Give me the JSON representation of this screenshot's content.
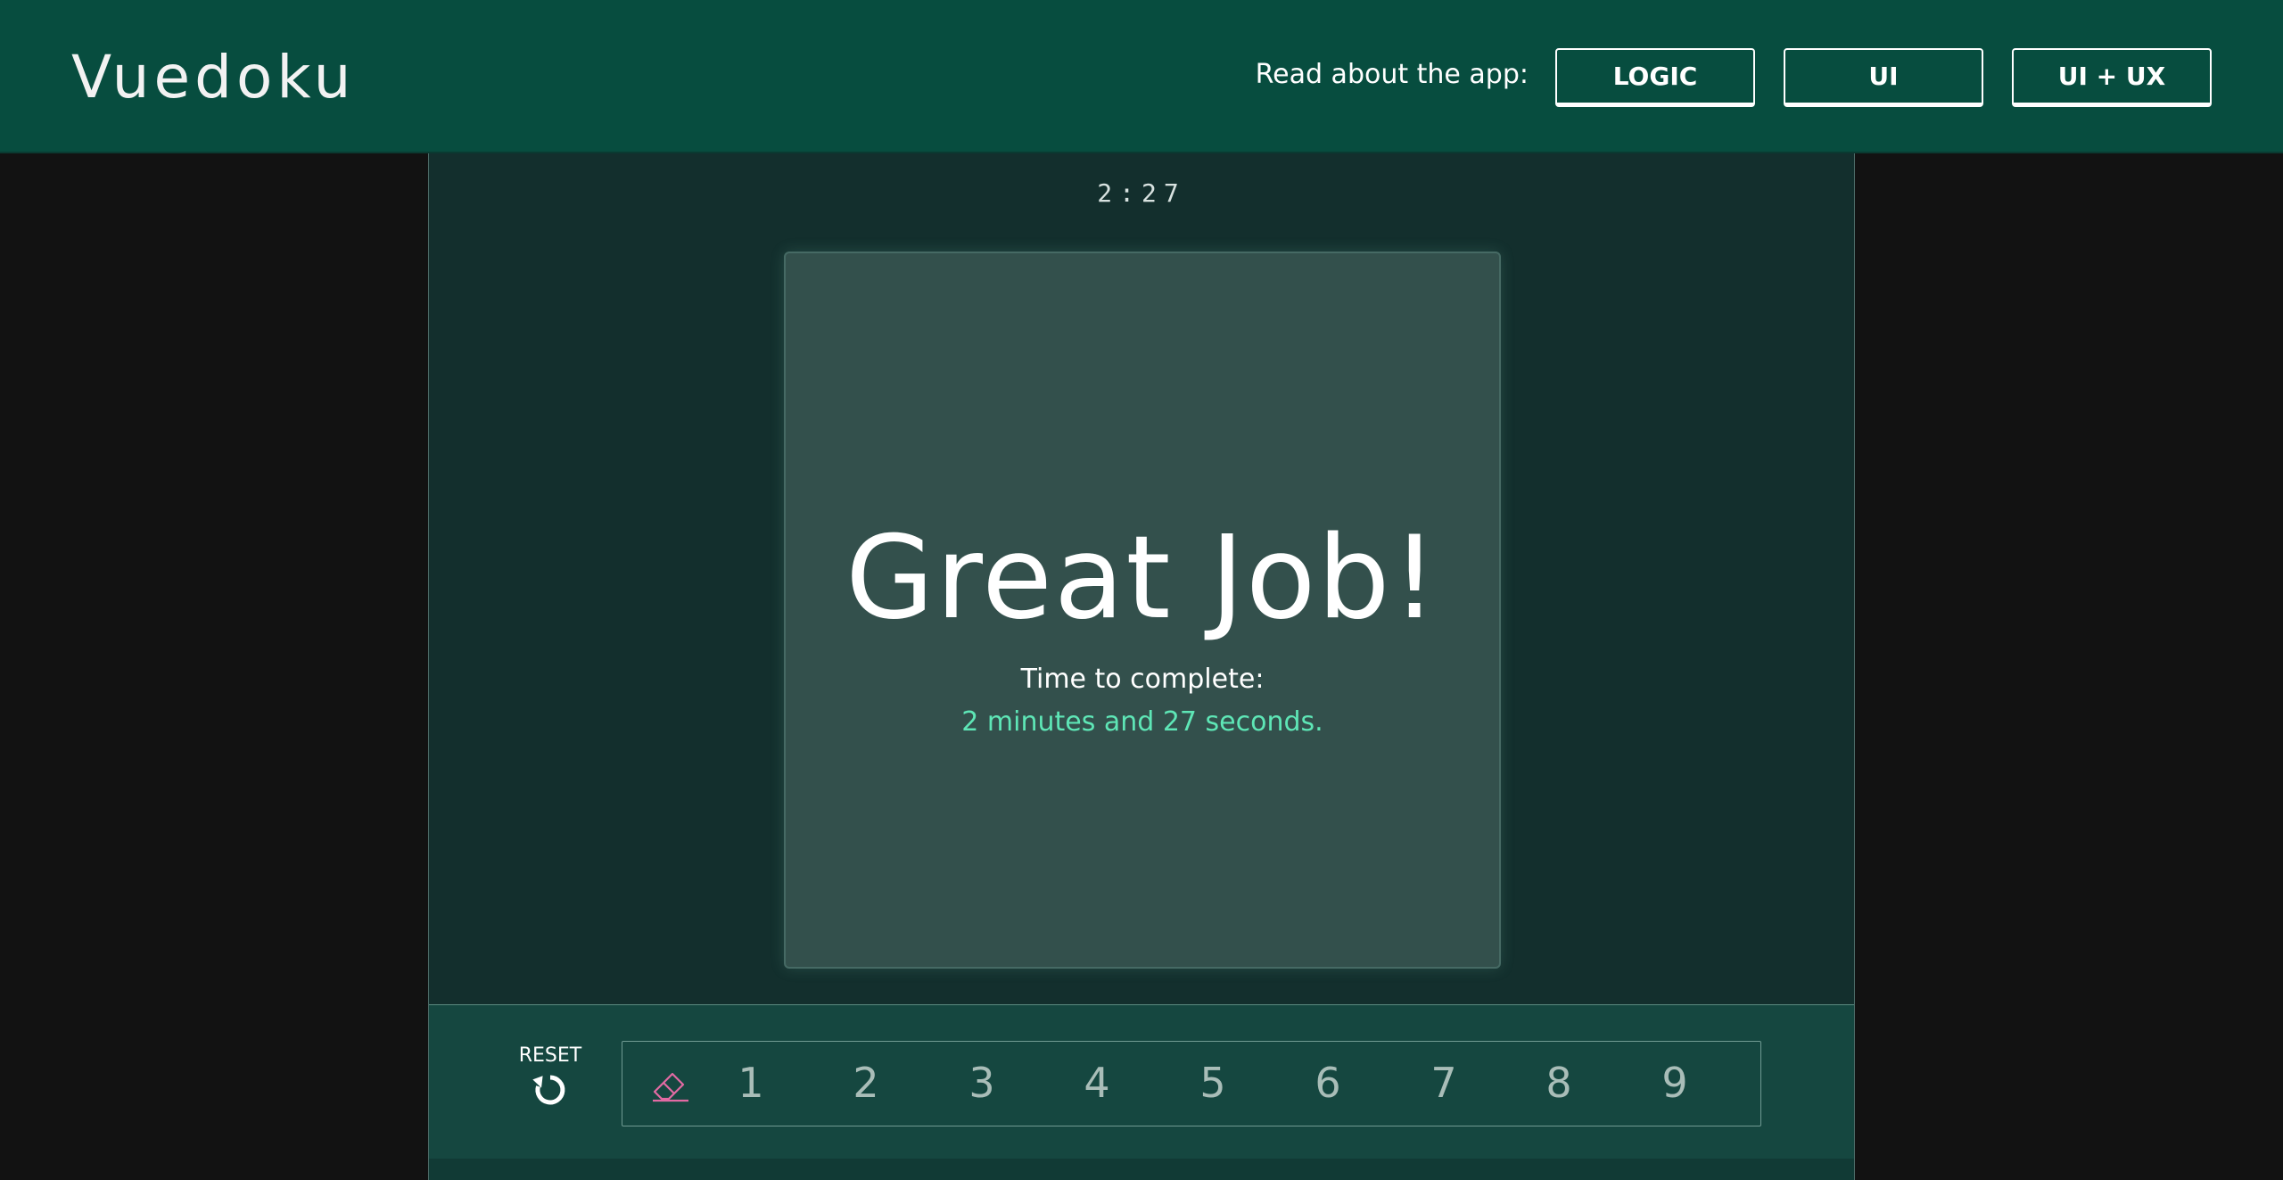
{
  "header": {
    "logo": "Vuedoku",
    "read_about_label": "Read about the app:",
    "buttons": [
      "LOGIC",
      "UI",
      "UI + UX"
    ]
  },
  "game": {
    "timer": "2:27",
    "title": "Great Job!",
    "time_label": "Time to complete:",
    "time_value": "2 minutes and 27 seconds."
  },
  "controls": {
    "reset_label": "RESET",
    "numbers": [
      "1",
      "2",
      "3",
      "4",
      "5",
      "6",
      "7",
      "8",
      "9"
    ]
  },
  "colors": {
    "header_bg": "#074d3f",
    "accent": "#5ee6b6",
    "eraser": "#e26aa3"
  },
  "icons": [
    "reset-icon",
    "eraser-icon"
  ]
}
